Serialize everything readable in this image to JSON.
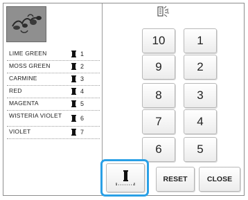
{
  "threads": [
    {
      "name": "LIME GREEN",
      "number": "1"
    },
    {
      "name": "MOSS GREEN",
      "number": "2"
    },
    {
      "name": "CARMINE",
      "number": "3"
    },
    {
      "name": "RED",
      "number": "4"
    },
    {
      "name": "MAGENTA",
      "number": "5"
    },
    {
      "name": "WISTERIA VIOLET",
      "number": "6"
    },
    {
      "name": "VIOLET",
      "number": "7"
    }
  ],
  "keypad": {
    "buttons": [
      "10",
      "1",
      "9",
      "2",
      "8",
      "3",
      "7",
      "4",
      "6",
      "5"
    ]
  },
  "actions": {
    "reset_label": "RESET",
    "close_label": "CLOSE"
  },
  "icons": {
    "preview": "embroidery-preview-image",
    "zoom": "zoom-magnifier-icon",
    "spool": "thread-spool-icon",
    "spool_button": "needle-bar-spool-icon"
  },
  "colors": {
    "highlight": "#2aa0e6",
    "preview_bg": "#8f8f8f"
  }
}
